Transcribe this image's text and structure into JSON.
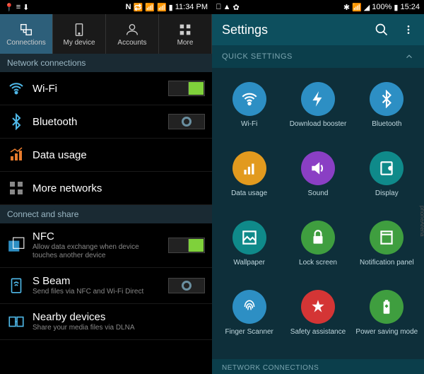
{
  "left": {
    "status": {
      "left_icons": [
        "📍",
        "☰",
        "⬇"
      ],
      "right_icons": [
        "N",
        "🔁",
        "📶",
        "🔋"
      ],
      "time": "11:34 PM"
    },
    "tabs": [
      {
        "label": "Connections",
        "icon": "connections"
      },
      {
        "label": "My device",
        "icon": "device"
      },
      {
        "label": "Accounts",
        "icon": "accounts"
      },
      {
        "label": "More",
        "icon": "more"
      }
    ],
    "sections": {
      "network": "Network connections",
      "connect": "Connect and share"
    },
    "items": {
      "wifi": {
        "title": "Wi-Fi",
        "state": "on"
      },
      "bt": {
        "title": "Bluetooth",
        "state": "off"
      },
      "data": {
        "title": "Data usage"
      },
      "more": {
        "title": "More networks"
      },
      "nfc": {
        "title": "NFC",
        "sub": "Allow data exchange when device touches another device",
        "state": "on"
      },
      "sbeam": {
        "title": "S Beam",
        "sub": "Send files via NFC and Wi-Fi Direct",
        "state": "off"
      },
      "nearby": {
        "title": "Nearby devices",
        "sub": "Share your media files via DLNA"
      }
    }
  },
  "right": {
    "status": {
      "left_icons": [
        "⎕",
        "▲",
        "⚙"
      ],
      "right_icons": [
        "✱",
        "📶",
        "📡",
        "100%"
      ],
      "time": "15:24"
    },
    "header": {
      "title": "Settings"
    },
    "qs_header": "QUICK SETTINGS",
    "grid": [
      {
        "label": "Wi-Fi",
        "color": "c-blue",
        "icon": "wifi"
      },
      {
        "label": "Download booster",
        "color": "c-blue",
        "icon": "bolt"
      },
      {
        "label": "Bluetooth",
        "color": "c-blue",
        "icon": "bt"
      },
      {
        "label": "Data usage",
        "color": "c-orange",
        "icon": "bars"
      },
      {
        "label": "Sound",
        "color": "c-purple",
        "icon": "sound"
      },
      {
        "label": "Display",
        "color": "c-teal",
        "icon": "display"
      },
      {
        "label": "Wallpaper",
        "color": "c-teal",
        "icon": "wallpaper"
      },
      {
        "label": "Lock screen",
        "color": "c-green",
        "icon": "lock"
      },
      {
        "label": "Notification panel",
        "color": "c-green",
        "icon": "panel"
      },
      {
        "label": "Finger Scanner",
        "color": "c-blue",
        "icon": "finger"
      },
      {
        "label": "Safety assistance",
        "color": "c-red",
        "icon": "safety"
      },
      {
        "label": "Power saving mode",
        "color": "c-green",
        "icon": "battery"
      }
    ],
    "net_header": "NETWORK CONNECTIONS",
    "watermark": "phoneArena"
  }
}
